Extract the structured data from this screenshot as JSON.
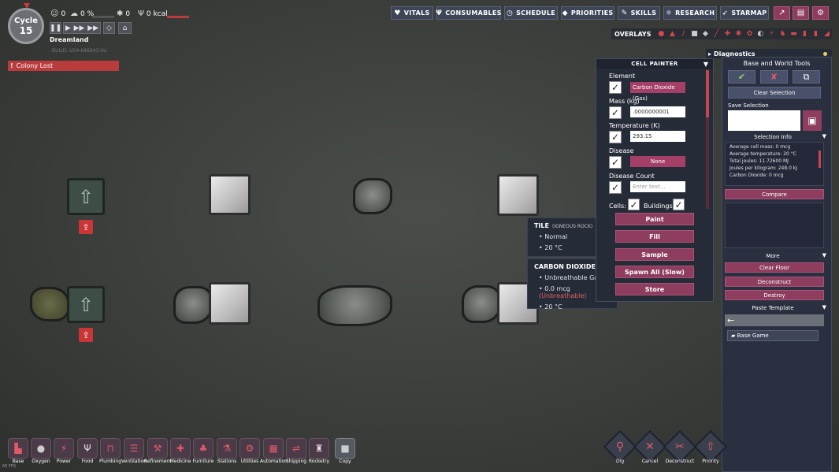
{
  "hud": {
    "cycle_label": "Cycle",
    "cycle_number": "15",
    "duplicants": "0",
    "stress": "0 %",
    "germs": "0",
    "food": "0 kcal",
    "colony_name": "Dreamland",
    "build": "BUILD: U54-646843-VU",
    "colony_lost": "Colony Lost"
  },
  "nav": {
    "vitals": "VITALS",
    "consumables": "CONSUMABLES",
    "schedule": "SCHEDULE",
    "priorities": "PRIORITIES",
    "skills": "SKILLS",
    "research": "RESEARCH",
    "starmap": "STARMAP",
    "overlays": "OVERLAYS"
  },
  "tooltip": {
    "tile_title": "TILE",
    "tile_sub": "(IGNEOUS ROCK)",
    "tile_rows": [
      "Normal",
      "20 °C"
    ],
    "gas_title": "CARBON DIOXIDE",
    "gas_row1": "Unbreathable Gas",
    "gas_mass": "0.0 mcg",
    "gas_mass_warn": "(Unbreathable)",
    "gas_temp": "20 °C"
  },
  "painter": {
    "header": "CELL PAINTER",
    "element_label": "Element",
    "element_value": "Carbon Dioxide (Gas)",
    "mass_label": "Mass (kg)",
    "mass_value": ".0000000001",
    "temp_label": "Temperature (K)",
    "temp_value": "293.15",
    "disease_label": "Disease",
    "disease_value": "None",
    "disease_count_label": "Disease Count",
    "disease_count_placeholder": "Enter text...",
    "cells_label": "Cells:",
    "buildings_label": "Buildings:",
    "buttons": [
      "Paint",
      "Fill",
      "Sample",
      "Spawn All (Slow)",
      "Store"
    ]
  },
  "diagnostics": "Diagnostics",
  "tools": {
    "title": "Base and World Tools",
    "clear_selection": "Clear Selection",
    "save_selection": "Save Selection",
    "selection_info": "Selection Info",
    "info_lines": [
      "Average cell mass: 0 mcg",
      "Average temperature: 20 °C",
      "Total joules: 11.72600 MJ",
      "Joules per kilogram: 248.0 kJ",
      "Carbon Dioxide: 0 mcg"
    ],
    "compare": "Compare",
    "more": "More",
    "clear_floor": "Clear Floor",
    "deconstruct": "Deconstruct",
    "destroy": "Destroy",
    "paste_template": "Paste Template",
    "template_item": "Base Game"
  },
  "build_menu": [
    "Base",
    "Oxygen",
    "Power",
    "Food",
    "Plumbing",
    "Ventilation",
    "Refinement",
    "Medicine",
    "Furniture",
    "Stations",
    "Utilities",
    "Automation",
    "Shipping",
    "Rocketry",
    "Copy"
  ],
  "right_tools": [
    "Dig",
    "Cancel",
    "Deconstruct",
    "Priority"
  ],
  "fps": "60 FPS",
  "colors": {
    "accent_pink": "#8e3d5e",
    "nav_bg": "#3d4557",
    "alert_red": "#b93b3b"
  }
}
